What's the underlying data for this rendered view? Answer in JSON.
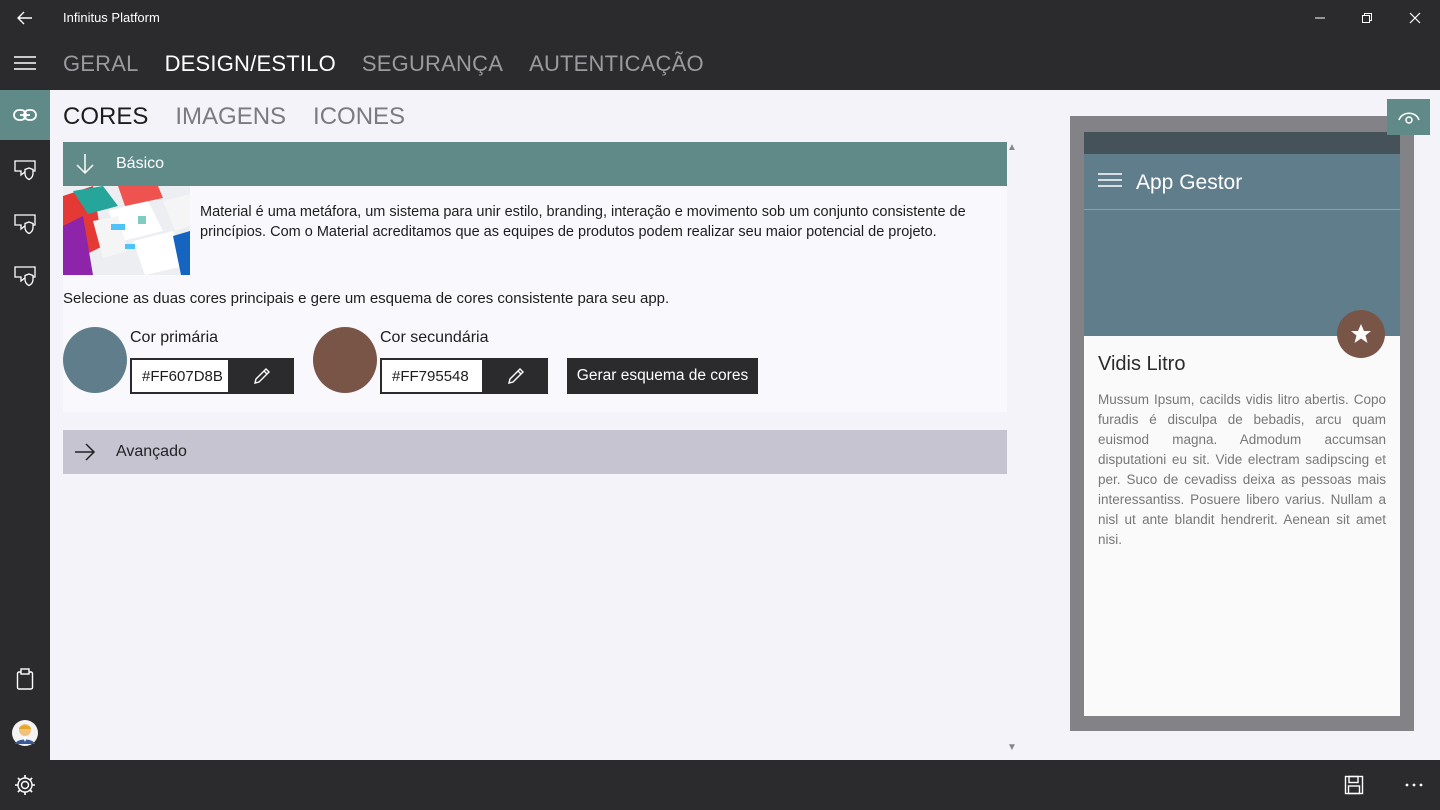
{
  "window": {
    "title": "Infinitus Platform"
  },
  "nav": {
    "tabs": [
      {
        "label": "GERAL"
      },
      {
        "label": "DESIGN/ESTILO"
      },
      {
        "label": "SEGURANÇA"
      },
      {
        "label": "AUTENTICAÇÃO"
      }
    ],
    "active_index": 1
  },
  "rail": {
    "items": [
      {
        "icon": "link-icon",
        "active": true
      },
      {
        "icon": "shield-chat-icon"
      },
      {
        "icon": "shield-chat-icon"
      },
      {
        "icon": "shield-chat-icon"
      }
    ],
    "bottom": [
      {
        "icon": "clipboard-icon"
      },
      {
        "icon": "avatar"
      }
    ]
  },
  "subtabs": [
    {
      "label": "CORES"
    },
    {
      "label": "IMAGENS"
    },
    {
      "label": "ICONES"
    }
  ],
  "basico": {
    "header": "Básico",
    "description": "Material é uma metáfora, um sistema para unir estilo, branding, interação e movimento sob um conjunto consistente de princípios. Com o Material acreditamos que as equipes de produtos podem realizar seu maior potencial de projeto.",
    "instruction": "Selecione as duas cores principais e gere um esquema de cores consistente para seu app.",
    "primary": {
      "label": "Cor primária",
      "value": "#FF607D8B",
      "color": "#607d8b"
    },
    "secondary": {
      "label": "Cor secundária",
      "value": "#FF795548",
      "color": "#795548"
    },
    "generate_label": "Gerar esquema de cores"
  },
  "avancado": {
    "header": "Avançado"
  },
  "preview": {
    "app_title": "App Gestor",
    "card_title": "Vidis Litro",
    "card_body": "Mussum Ipsum, cacilds vidis litro abertis. Copo furadis é disculpa de bebadis, arcu quam euismod magna. Admodum accumsan disputationi eu sit. Vide electram sadipscing et per. Suco de cevadiss deixa as pessoas mais interessantiss. Posuere libero varius. Nullam a nisl ut ante blandit hendrerit. Aenean sit amet nisi.",
    "colors": {
      "primary": "#607d8b",
      "secondary": "#795548"
    }
  },
  "colors": {
    "accent": "#5f8a88",
    "chrome": "#2b2b2e",
    "advanced_bg": "#c6c4d0"
  }
}
